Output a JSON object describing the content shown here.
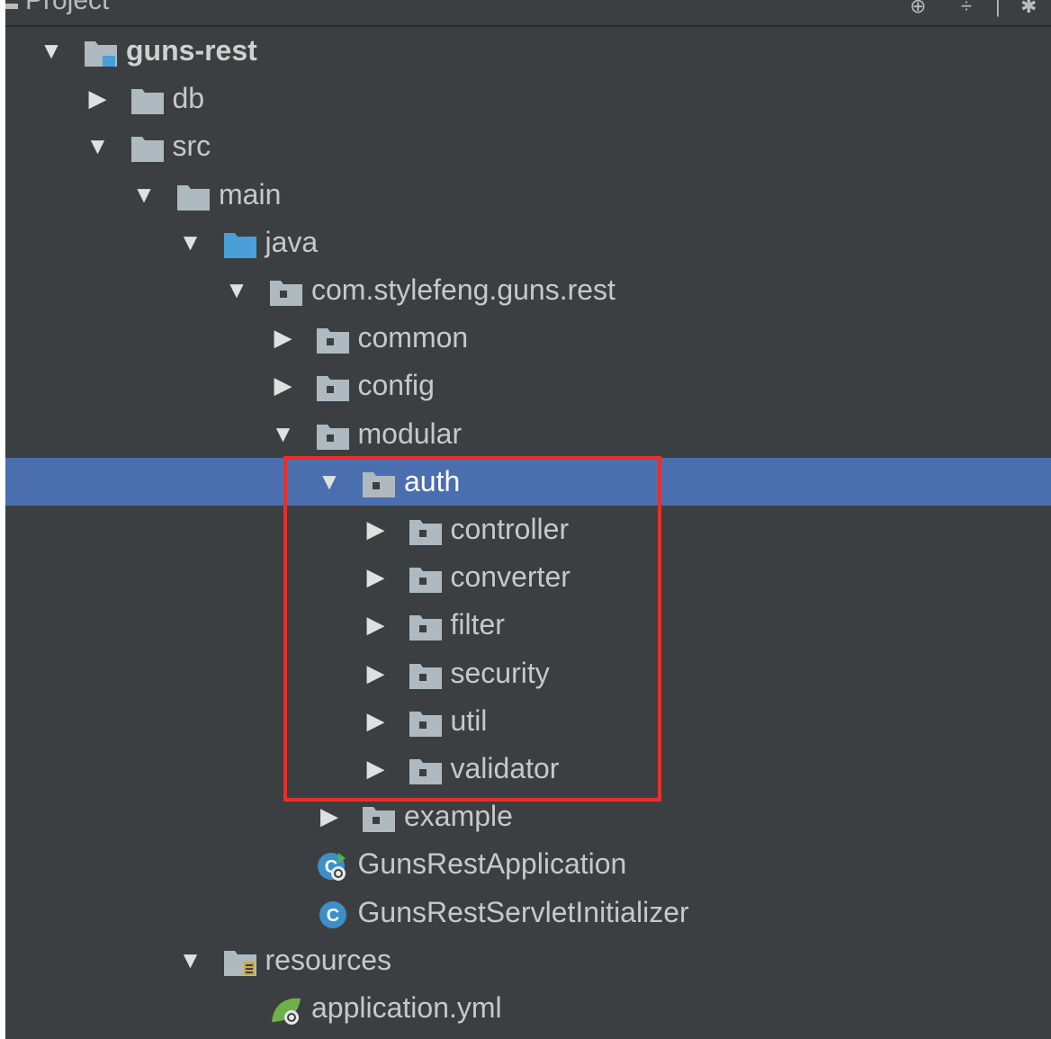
{
  "panel": {
    "title": "Project"
  },
  "tree": [
    {
      "label": "guns-rest",
      "icon": "module-folder-icon",
      "expanded": true,
      "root": true
    },
    {
      "label": "db",
      "icon": "folder-icon",
      "expanded": false
    },
    {
      "label": "src",
      "icon": "folder-icon",
      "expanded": true
    },
    {
      "label": "main",
      "icon": "folder-icon",
      "expanded": true
    },
    {
      "label": "java",
      "icon": "source-folder-icon",
      "expanded": true
    },
    {
      "label": "com.stylefeng.guns.rest",
      "icon": "package-icon",
      "expanded": true
    },
    {
      "label": "common",
      "icon": "package-icon",
      "expanded": false
    },
    {
      "label": "config",
      "icon": "package-icon",
      "expanded": false
    },
    {
      "label": "modular",
      "icon": "package-icon",
      "expanded": true
    },
    {
      "label": "auth",
      "icon": "package-icon",
      "expanded": true,
      "selected": true
    },
    {
      "label": "controller",
      "icon": "package-icon",
      "expanded": false
    },
    {
      "label": "converter",
      "icon": "package-icon",
      "expanded": false
    },
    {
      "label": "filter",
      "icon": "package-icon",
      "expanded": false
    },
    {
      "label": "security",
      "icon": "package-icon",
      "expanded": false
    },
    {
      "label": "util",
      "icon": "package-icon",
      "expanded": false
    },
    {
      "label": "validator",
      "icon": "package-icon",
      "expanded": false
    },
    {
      "label": "example",
      "icon": "package-icon",
      "expanded": false
    },
    {
      "label": "GunsRestApplication",
      "icon": "spring-boot-class-icon"
    },
    {
      "label": "GunsRestServletInitializer",
      "icon": "class-icon"
    },
    {
      "label": "resources",
      "icon": "resources-folder-icon",
      "expanded": true
    },
    {
      "label": "application.yml",
      "icon": "spring-yml-icon"
    }
  ],
  "colors": {
    "background": "#3c3f41",
    "selection": "#4b6eaf",
    "highlight_box": "#e5312b",
    "folder": "#aeb9c0",
    "source_folder": "#4a9fd8",
    "class": "#3d8fc7"
  }
}
